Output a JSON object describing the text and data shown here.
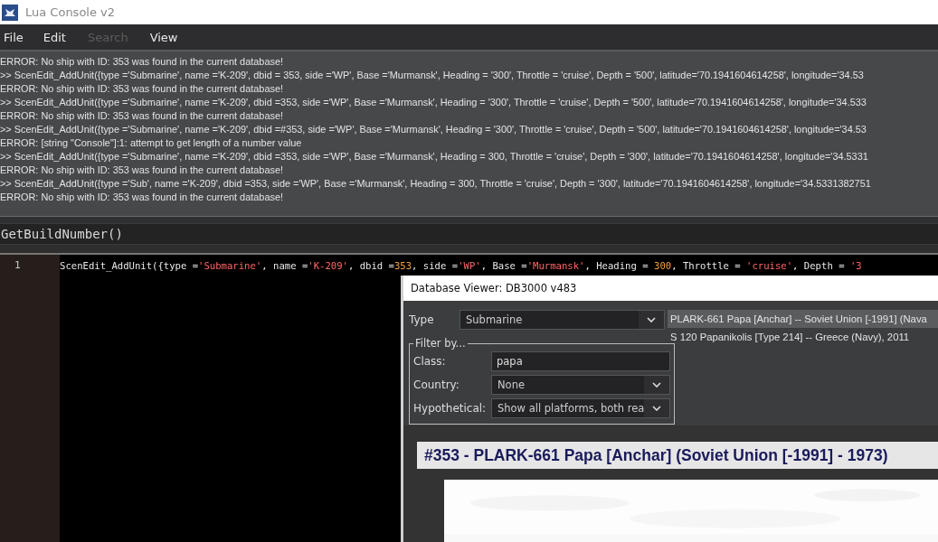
{
  "window": {
    "title": "Lua Console v2"
  },
  "menu": [
    {
      "label": "File",
      "disabled": false
    },
    {
      "label": "Edit",
      "disabled": false
    },
    {
      "label": "Search",
      "disabled": true
    },
    {
      "label": "View",
      "disabled": false
    }
  ],
  "console_lines": [
    "ERROR: No ship with ID: 353 was found in the current database!",
    ">> ScenEdit_AddUnit({type ='Submarine', name ='K-209', dbid = 353, side ='WP', Base ='Murmansk', Heading = '300', Throttle = 'cruise', Depth = '500', latitude='70.1941604614258', longitude='34.53",
    "ERROR: No ship with ID: 353 was found in the current database!",
    ">> ScenEdit_AddUnit({type ='Submarine', name ='K-209', dbid =353, side ='WP', Base ='Murmansk', Heading = '300', Throttle = 'cruise', Depth = '500', latitude='70.1941604614258', longitude='34.533",
    "ERROR: No ship with ID: 353 was found in the current database!",
    ">> ScenEdit_AddUnit({type ='Submarine', name ='K-209', dbid =#353, side ='WP', Base ='Murmansk', Heading = '300', Throttle = 'cruise', Depth = '500', latitude='70.1941604614258', longitude='34.53",
    "ERROR:  [string \"Console\"]:1: attempt to get length of a number value",
    ">> ScenEdit_AddUnit({type ='Submarine', name ='K-209', dbid =353, side ='WP', Base ='Murmansk', Heading = 300, Throttle = 'cruise', Depth = '300', latitude='70.1941604614258', longitude='34.5331",
    "ERROR: No ship with ID: 353 was found in the current database!",
    ">> ScenEdit_AddUnit({type ='Sub', name ='K-209', dbid =353, side ='WP', Base ='Murmansk', Heading = 300, Throttle = 'cruise', Depth = '300', latitude='70.1941604614258', longitude='34.5331382751",
    "ERROR: No ship with ID: 353 was found in the current database!"
  ],
  "command_input": {
    "value": "GetBuildNumber()"
  },
  "editor": {
    "lines": [
      {
        "number": "1",
        "tokens": [
          {
            "kind": "plain",
            "text": "ScenEdit_AddUnit({type ="
          },
          {
            "kind": "string",
            "text": "'Submarine'"
          },
          {
            "kind": "plain",
            "text": ", name ="
          },
          {
            "kind": "string",
            "text": "'K-209'"
          },
          {
            "kind": "plain",
            "text": ", dbid ="
          },
          {
            "kind": "number",
            "text": "353"
          },
          {
            "kind": "plain",
            "text": ", side ="
          },
          {
            "kind": "string",
            "text": "'WP'"
          },
          {
            "kind": "plain",
            "text": ", Base ="
          },
          {
            "kind": "string",
            "text": "'Murmansk'"
          },
          {
            "kind": "plain",
            "text": ", Heading = "
          },
          {
            "kind": "number",
            "text": "300"
          },
          {
            "kind": "plain",
            "text": ", Throttle = "
          },
          {
            "kind": "string",
            "text": "'cruise'"
          },
          {
            "kind": "plain",
            "text": ", Depth = "
          },
          {
            "kind": "string",
            "text": "'3"
          }
        ]
      }
    ]
  },
  "dialog": {
    "title": "Database Viewer: DB3000 v483",
    "type": {
      "label": "Type",
      "value": "Submarine"
    },
    "filter": {
      "title": "Filter by...",
      "class": {
        "label": "Class:",
        "value": "papa"
      },
      "country": {
        "label": "Country:",
        "value": "None"
      },
      "hypothetical": {
        "label": "Hypothetical:",
        "value": "Show all platforms, both rea"
      }
    },
    "results": [
      {
        "label": "PLARK-661 Papa [Anchar] -- Soviet Union [-1991] (Nava",
        "selected": true
      },
      {
        "label": "S 120 Papanikolis [Type 214] -- Greece (Navy), 2011",
        "selected": false
      }
    ],
    "heading": "#353 - PLARK-661 Papa [Anchar] (Soviet Union [-1991] - 1973)"
  }
}
